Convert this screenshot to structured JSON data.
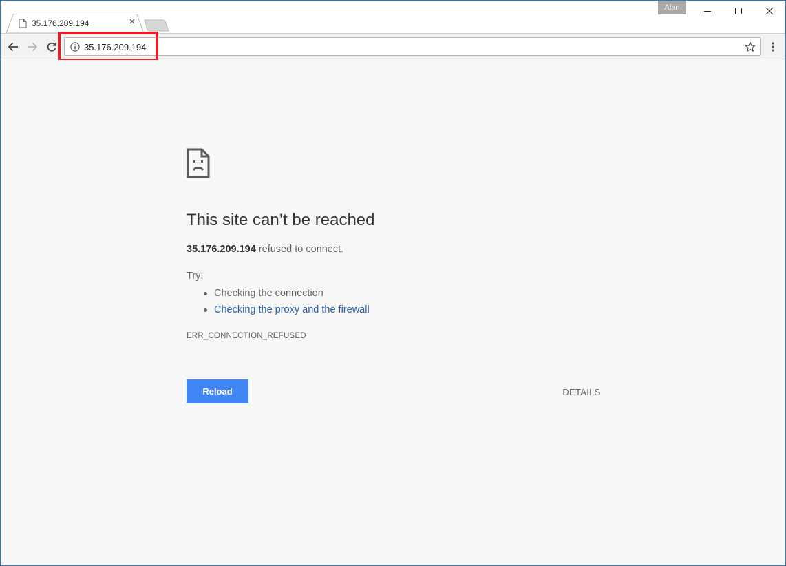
{
  "tab": {
    "title": "35.176.209.194",
    "close_glyph": "×",
    "icon": "page-icon"
  },
  "window": {
    "profile_name": "Alan",
    "minimize_icon": "minimize-icon",
    "maximize_icon": "maximize-icon",
    "close_icon": "close-icon"
  },
  "toolbar": {
    "back_icon": "back-arrow-icon",
    "forward_icon": "forward-arrow-icon",
    "reload_icon": "reload-icon",
    "url": "35.176.209.194",
    "site_info_icon": "info-icon",
    "bookmark_icon": "star-icon",
    "menu_icon": "kebab-menu-icon"
  },
  "error_page": {
    "title": "This site can’t be reached",
    "host": "35.176.209.194",
    "message": " refused to connect.",
    "try_label": "Try:",
    "suggestions": [
      "Checking the connection",
      "Checking the proxy and the firewall"
    ],
    "error_code": "ERR_CONNECTION_REFUSED",
    "reload_label": "Reload",
    "details_label": "DETAILS"
  },
  "colors": {
    "accent_button": "#4285f4",
    "link": "#2b5ea7",
    "highlight_box": "#e0202a",
    "page_background": "#f7f7f7"
  }
}
